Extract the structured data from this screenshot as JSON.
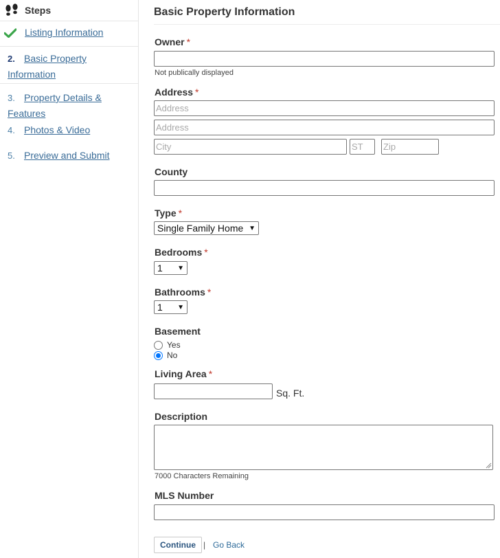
{
  "sidebar": {
    "title": "Steps",
    "steps": [
      {
        "num": "",
        "label": "Listing Information",
        "state": "done"
      },
      {
        "num": "2.",
        "label": "Basic Property Information",
        "state": "current"
      },
      {
        "num": "3.",
        "label": "Property Details & Features",
        "state": "todo"
      },
      {
        "num": "4.",
        "label": "Photos & Video",
        "state": "todo"
      },
      {
        "num": "5.",
        "label": "Preview and Submit",
        "state": "todo"
      }
    ]
  },
  "form": {
    "title": "Basic Property Information",
    "required_mark": "*",
    "owner": {
      "label": "Owner",
      "value": "",
      "hint": "Not publically displayed"
    },
    "address": {
      "label": "Address",
      "line1_placeholder": "Address",
      "line2_placeholder": "Address",
      "city_placeholder": "City",
      "state_placeholder": "ST",
      "zip_placeholder": "Zip"
    },
    "county": {
      "label": "County",
      "value": ""
    },
    "type": {
      "label": "Type",
      "selected": "Single Family Home"
    },
    "bedrooms": {
      "label": "Bedrooms",
      "selected": "1"
    },
    "bathrooms": {
      "label": "Bathrooms",
      "selected": "1"
    },
    "basement": {
      "label": "Basement",
      "options": [
        "Yes",
        "No"
      ],
      "selected": "No"
    },
    "living_area": {
      "label": "Living Area",
      "value": "",
      "unit": "Sq. Ft."
    },
    "description": {
      "label": "Description",
      "value": "",
      "counter": "7000 Characters Remaining"
    },
    "mls": {
      "label": "MLS Number",
      "value": ""
    }
  },
  "actions": {
    "continue_label": "Continue",
    "separator": "|",
    "back_label": "Go Back"
  }
}
